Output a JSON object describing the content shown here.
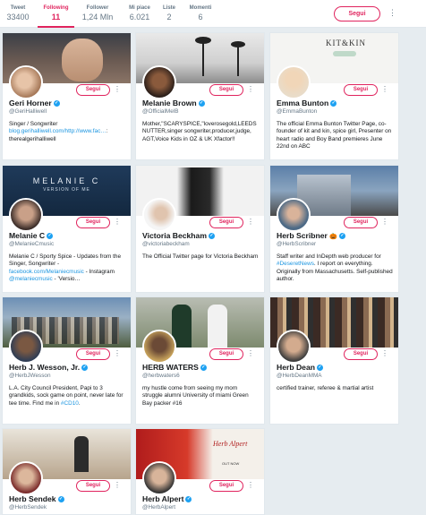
{
  "stats": [
    {
      "label": "Tweet",
      "value": "33400",
      "active": false
    },
    {
      "label": "Following",
      "value": "11",
      "active": true
    },
    {
      "label": "Follower",
      "value": "1,24 Mln",
      "active": false
    },
    {
      "label": "Mi piace",
      "value": "6.021",
      "active": false
    },
    {
      "label": "Liste",
      "value": "2",
      "active": false
    },
    {
      "label": "Momenti",
      "value": "6",
      "active": false
    }
  ],
  "header": {
    "follow_label": "Segui",
    "more_icon": "more-vertical-icon"
  },
  "card_follow_label": "Segui",
  "verified_icon": "verified-check-icon",
  "colors": {
    "accent": "#e0245e",
    "link": "#1b95e0",
    "verified": "#1da1f2",
    "muted": "#657786"
  },
  "cards": [
    {
      "name": "Geri Horner",
      "handle": "@GeriHalliwell",
      "verified": true,
      "bio": "Singer / Songwriter",
      "link": "blog.gerihalliwell.com/http://www.fac…",
      "bio2": ": therealgerihalliwell"
    },
    {
      "name": "Melanie Brown",
      "handle": "@OfficialMelB",
      "verified": true,
      "bio": "Mother,\"SCARYSPICE,\"loverosegold,LEEDSNUTTER,singer songwriter,producer,judge, AGT,Voice Kids in OZ & UK Xfactor!!"
    },
    {
      "name": "Emma Bunton",
      "handle": "@EmmaBunton",
      "verified": true,
      "banner_text": "KIT&KIN",
      "bio": "The official Emma Bunton Twitter Page, co-founder of kit and kin, spice girl, Presenter on heart radio and Boy Band premieres June 22nd on ABC"
    },
    {
      "name": "Melanie C",
      "handle": "@MelanieCmusic",
      "verified": true,
      "banner_text": "MELANIE C",
      "banner_sub": "VERSION OF ME",
      "bio": "Melanie C / Sporty Spice - Updates from the Singer, Songwriter - ",
      "link": "facebook.com/Melaniecmusic",
      "bio2": " - Instagram ",
      "link2": "@melaniecmusic",
      "bio3": " - 'Versio…"
    },
    {
      "name": "Victoria Beckham",
      "handle": "@victoriabeckham",
      "verified": true,
      "bio": "The Official Twitter page for Victoria Beckham"
    },
    {
      "name": "Herb Scribner",
      "handle": "@HerbScribner",
      "verified": true,
      "emoji": "🎃",
      "bio": "Staff writer and InDepth web producer for ",
      "link": "#DeseretNews",
      "bio2": ". I report on everything. Originally from Massachusetts. Self-published author."
    },
    {
      "name": "Herb J. Wesson, Jr.",
      "handle": "@HerbJWesson",
      "verified": true,
      "bio": "L.A. City Council President, Papi to 3 grandkids, sock game on point, never late for tee time. Find me in ",
      "link": "#CD10",
      "bio2": "."
    },
    {
      "name": "HERB WATERS",
      "handle": "@herbwaters6",
      "verified": true,
      "bio": "my hustle come from seeing my mom struggle alumni University of miami Green Bay packer #16"
    },
    {
      "name": "Herb Dean",
      "handle": "@HerbDeanMMA",
      "verified": true,
      "bio": "certified trainer, referee & martial artist"
    },
    {
      "name": "Herb Sendek",
      "handle": "@HerbSendek",
      "verified": true,
      "bio": ""
    },
    {
      "name": "Herb Alpert",
      "handle": "@HerbAlpert",
      "verified": true,
      "bio": "",
      "banner_text": "Herb Alpert",
      "banner_sub": "OUT NOW"
    }
  ]
}
